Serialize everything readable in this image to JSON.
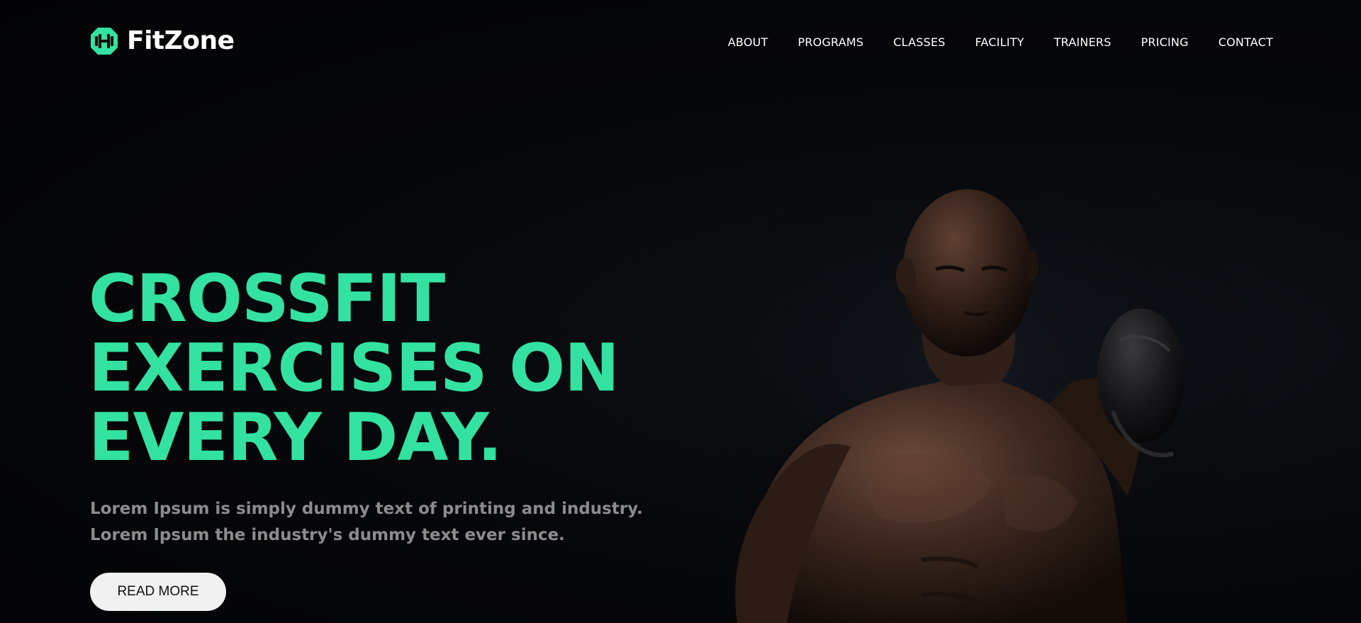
{
  "brand": {
    "name": "FitZone",
    "accent": "#33e2a0",
    "icon": "dumbbell-icon"
  },
  "nav": {
    "items": [
      {
        "label": "ABOUT"
      },
      {
        "label": "PROGRAMS"
      },
      {
        "label": "CLASSES"
      },
      {
        "label": "FACILITY"
      },
      {
        "label": "TRAINERS"
      },
      {
        "label": "PRICING"
      },
      {
        "label": "CONTACT"
      }
    ]
  },
  "hero": {
    "title_lines": [
      "CROSSFIT",
      "EXERCISES ON",
      "EVERY DAY."
    ],
    "description": "Lorem Ipsum is simply dummy text of printing and industry. Lorem Ipsum the industry's dummy text ever since.",
    "cta_label": "READ MORE",
    "image": "boxer-photo"
  }
}
